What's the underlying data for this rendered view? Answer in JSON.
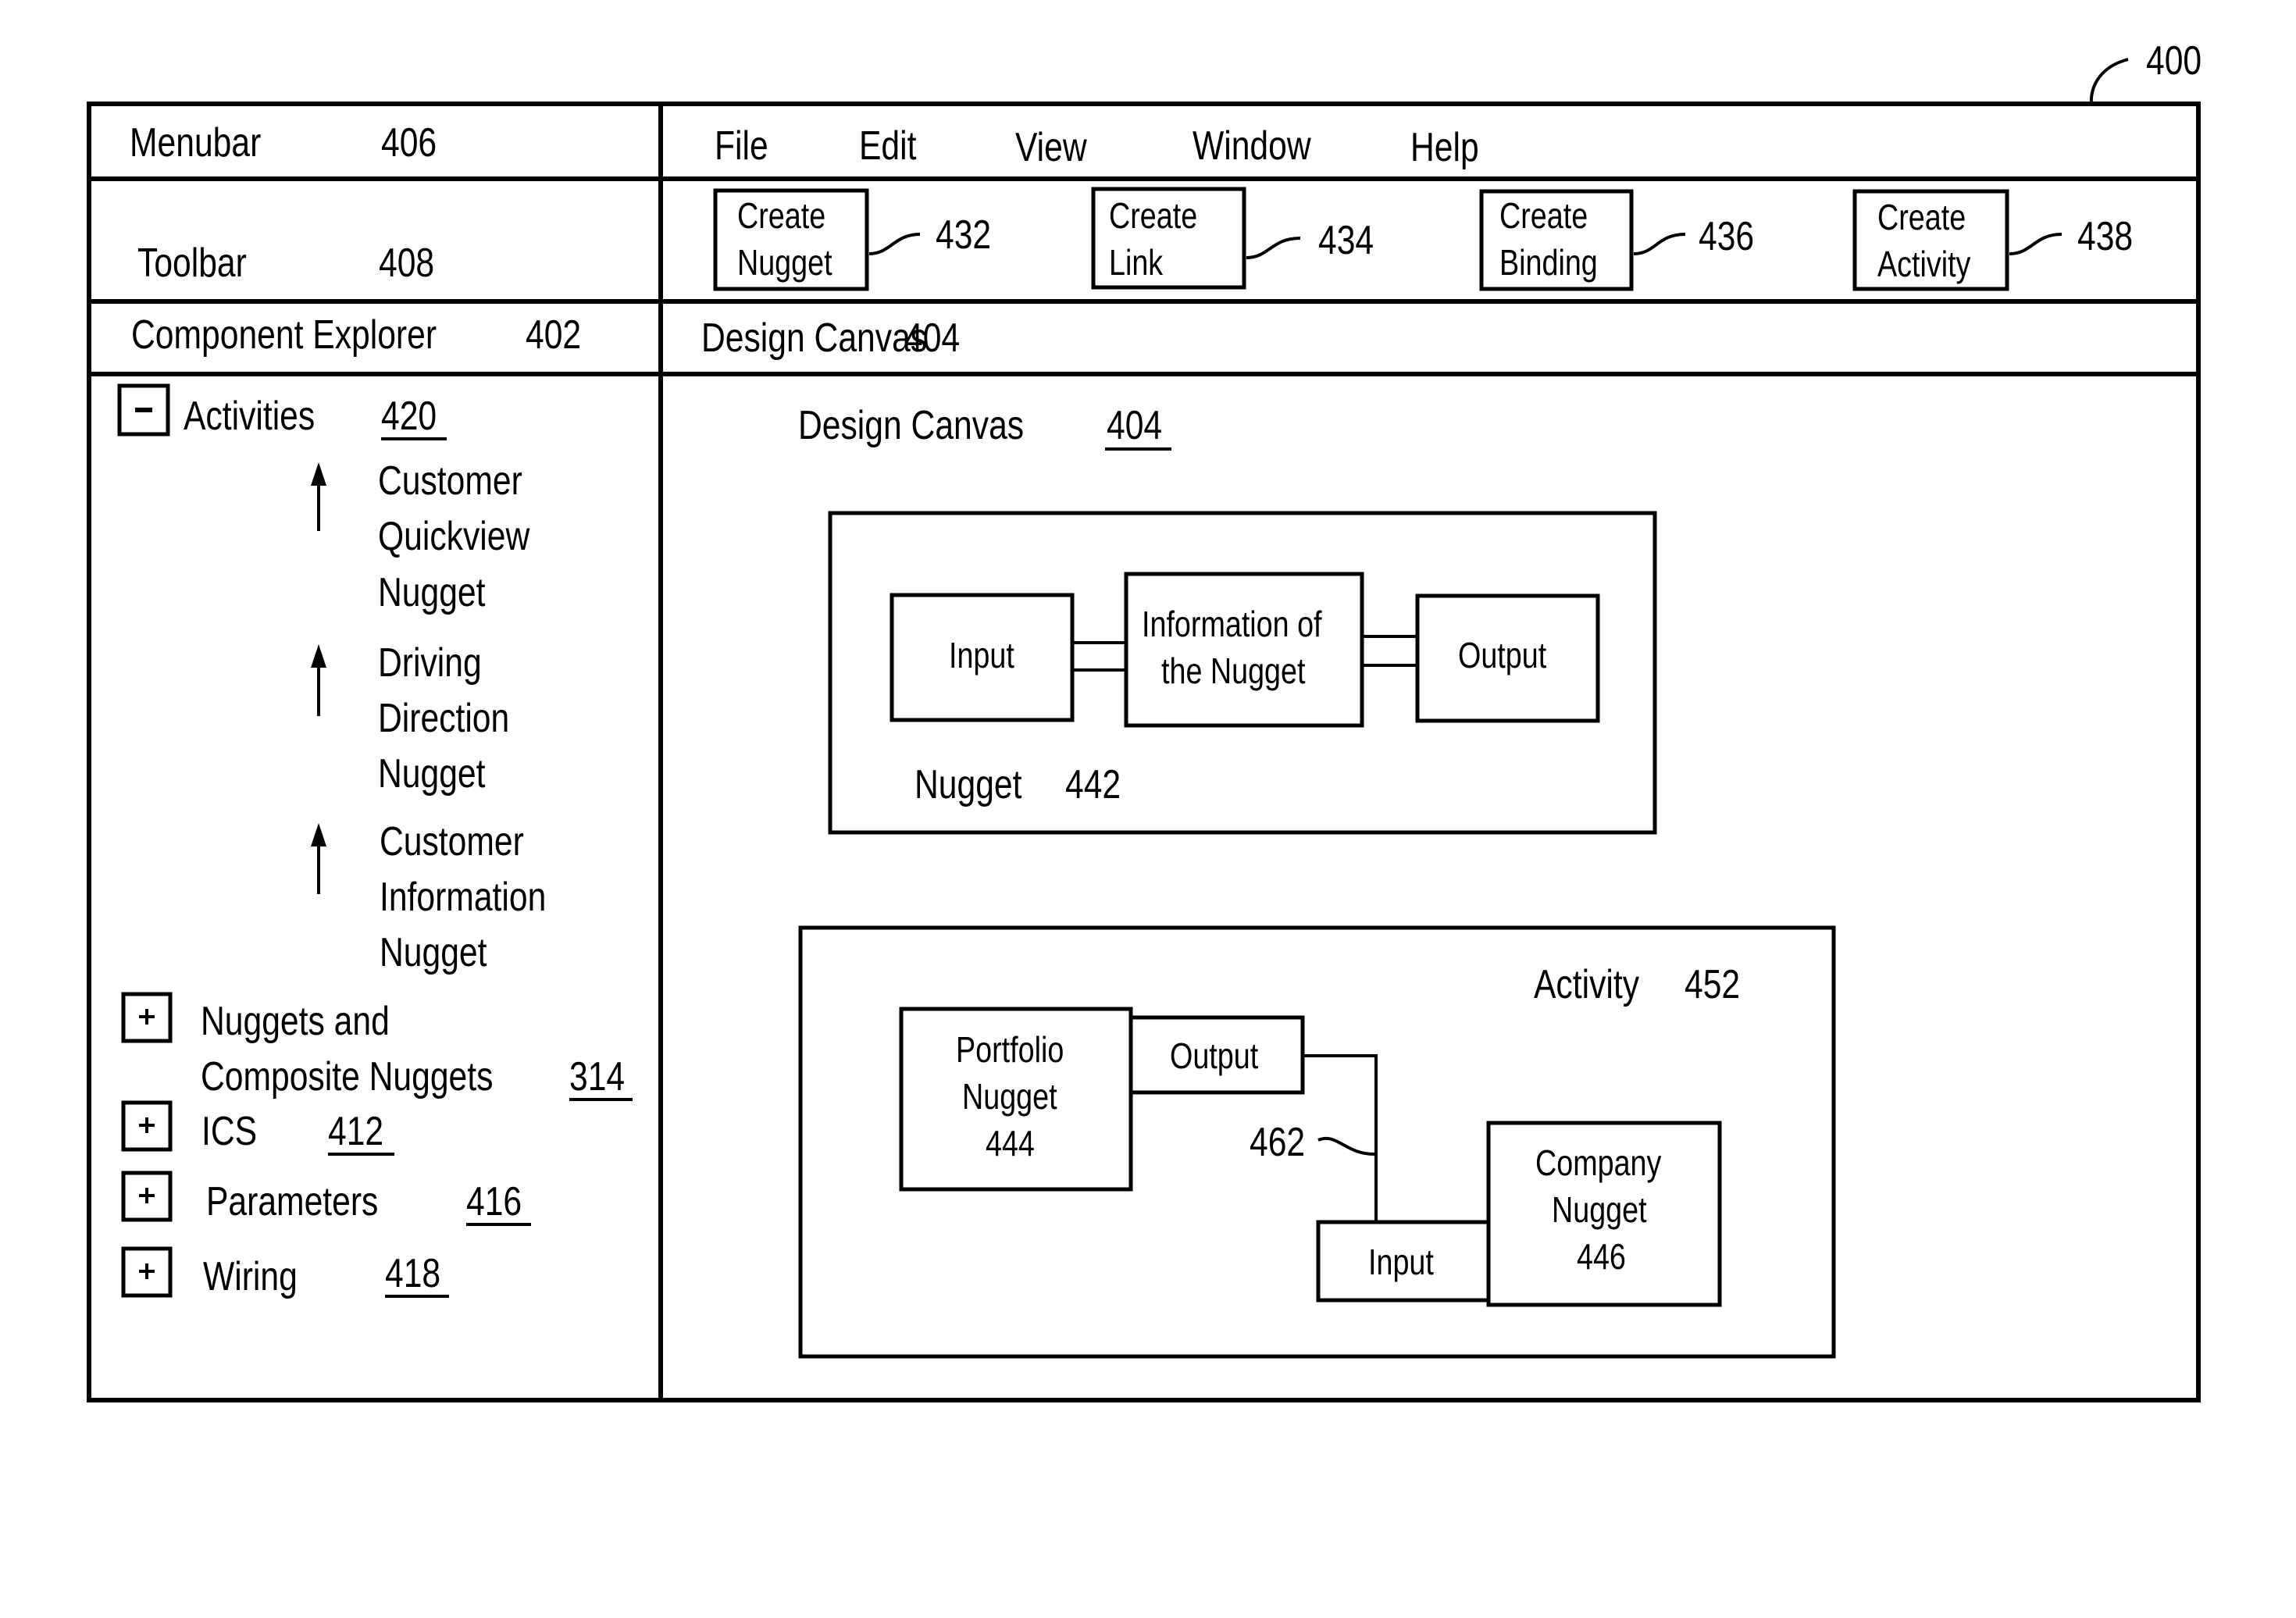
{
  "figure": {
    "ref": "400"
  },
  "left_panel": {
    "menubar": {
      "label": "Menubar",
      "ref": "406"
    },
    "toolbar": {
      "label": "Toolbar",
      "ref": "408"
    },
    "component_explorer": {
      "label": "Component Explorer",
      "ref": "402"
    },
    "tree": {
      "activities": {
        "toggle": "-",
        "label": "Activities",
        "ref": "420",
        "children": [
          {
            "lines": [
              "Customer",
              "Quickview",
              "Nugget"
            ],
            "icon": "up-arrow-icon"
          },
          {
            "lines": [
              "Driving",
              "Direction",
              "Nugget"
            ],
            "icon": "up-arrow-icon"
          },
          {
            "lines": [
              "Customer",
              "Information",
              "Nugget"
            ],
            "icon": "up-arrow-icon"
          }
        ]
      },
      "nodes": [
        {
          "toggle": "+",
          "lines": [
            "Nuggets and",
            "Composite Nuggets"
          ],
          "ref": "314"
        },
        {
          "toggle": "+",
          "lines": [
            "ICS"
          ],
          "ref": "412"
        },
        {
          "toggle": "+",
          "lines": [
            "Parameters"
          ],
          "ref": "416"
        },
        {
          "toggle": "+",
          "lines": [
            "Wiring"
          ],
          "ref": "418"
        }
      ]
    }
  },
  "menu": {
    "items": [
      "File",
      "Edit",
      "View",
      "Window",
      "Help"
    ]
  },
  "toolbar": {
    "buttons": [
      {
        "lines": [
          "Create",
          "Nugget"
        ],
        "ref": "432"
      },
      {
        "lines": [
          "Create",
          "Link"
        ],
        "ref": "434"
      },
      {
        "lines": [
          "Create",
          "Binding"
        ],
        "ref": "436"
      },
      {
        "lines": [
          "Create",
          "Activity"
        ],
        "ref": "438"
      }
    ]
  },
  "canvas": {
    "header": {
      "label": "Design Canvas",
      "ref": "404"
    },
    "inner_title": {
      "label": "Design Canvas",
      "ref": "404"
    },
    "nugget": {
      "label": "Nugget",
      "ref": "442",
      "input": "Input",
      "info_lines": [
        "Information of",
        "the Nugget"
      ],
      "output": "Output"
    },
    "activity": {
      "label": "Activity",
      "ref": "452",
      "portfolio": {
        "lines": [
          "Portfolio",
          "Nugget",
          "444"
        ]
      },
      "portfolio_output": "Output",
      "company": {
        "lines": [
          "Company",
          "Nugget",
          "446"
        ]
      },
      "company_input": "Input",
      "wire_ref": "462"
    }
  }
}
